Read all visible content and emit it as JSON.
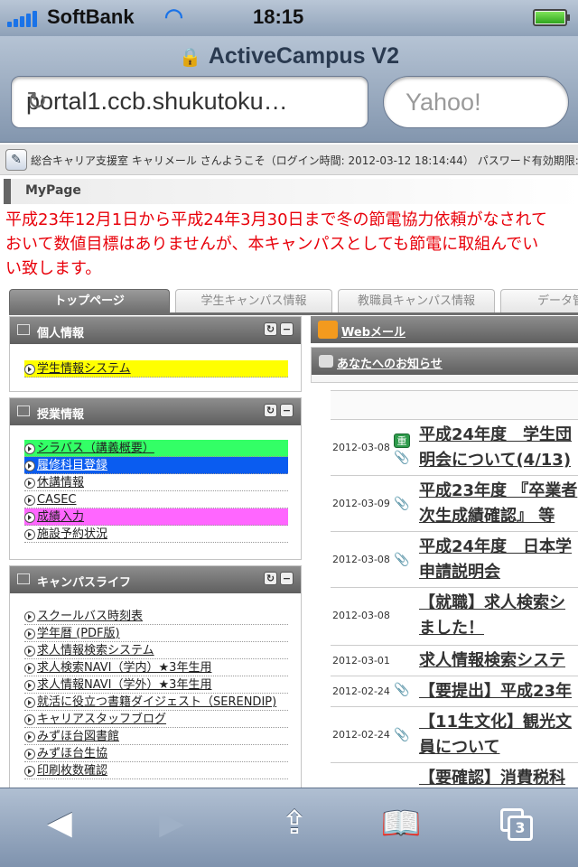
{
  "status_bar": {
    "carrier": "SoftBank",
    "time": "18:15"
  },
  "browser": {
    "title": "ActiveCampus V2",
    "url": "portal1.ccb.shukutoku…",
    "search_placeholder": "Yahoo!"
  },
  "welcome": "総合キャリア支援室 キャリメール さんようこそ（ログイン時間: 2012-03-12 18:14:44） パスワード有効期限: ",
  "mypage_title": "MyPage",
  "notice": {
    "line1": "平成23年12月1日から平成24年3月30日まで冬の節電協力依頼がなされて",
    "line2": "おいて数値目標はありませんが、本キャンパスとしても節電に取組んでい",
    "line3": "い致します。"
  },
  "tabs": [
    "トップページ",
    "学生キャンパス情報",
    "教職員キャンパス情報",
    "データ管"
  ],
  "panels": {
    "personal": {
      "title": "個人情報",
      "items": [
        "学生情報システム"
      ]
    },
    "classes": {
      "title": "授業情報",
      "items": [
        "シラバス（講義概要）",
        "履修科目登録",
        "休講情報",
        "CASEC",
        "成績入力",
        "施設予約状況"
      ]
    },
    "campus_life": {
      "title": "キャンパスライフ",
      "items": [
        "スクールバス時刻表",
        "学年暦 (PDF版)",
        "求人情報検索システム",
        "求人検索NAVI（学内）★3年生用",
        "求人情報NAVI（学外）★3年生用",
        "就活に役立つ書籍ダイジェスト（SERENDIP)",
        "キャリアスタッフブログ",
        "みずほ台図書館",
        "みずほ台生協",
        "印刷枚数確認"
      ]
    }
  },
  "right": {
    "webmail": "Webメール",
    "notices_title": "あなたへのお知らせ",
    "badge_important": "重",
    "news": [
      {
        "date": "2012-03-08",
        "line1": "平成24年度　学生団",
        "line2": "明会について(4/13)"
      },
      {
        "date": "2012-03-09",
        "line1": "平成23年度 『卒業者",
        "line2": "次生成績確認』 等"
      },
      {
        "date": "2012-03-08",
        "line1": "平成24年度　日本学",
        "line2": "申請説明会"
      },
      {
        "date": "2012-03-08",
        "line1": "【就職】求人検索シ",
        "line2": "ました！"
      },
      {
        "date": "2012-03-01",
        "line1": "求人情報検索システ",
        "line2": ""
      },
      {
        "date": "2012-02-24",
        "line1": "【要提出】平成23年",
        "line2": ""
      },
      {
        "date": "2012-02-24",
        "line1": "【11生文化】観光文",
        "line2": "員について"
      },
      {
        "date": "",
        "line1": "【要確認】消費税科",
        "line2": ""
      }
    ]
  },
  "toolbar": {
    "tab_count": "3"
  },
  "colors": {
    "yellow": "#ffff00",
    "green": "#33ff66",
    "blue": "#0a5cf0",
    "magenta": "#ff66ff",
    "notice_red": "#e8000a"
  }
}
